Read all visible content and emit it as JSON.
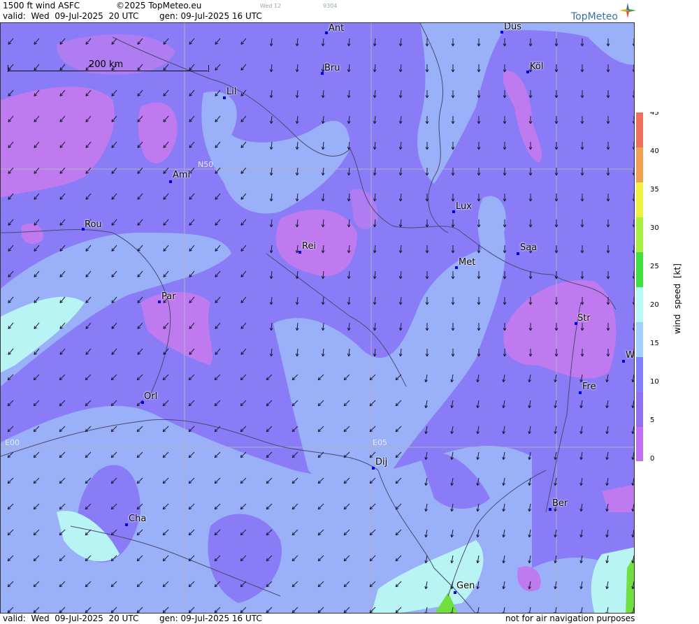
{
  "header": {
    "title": "1500 ft wind ASFC",
    "copyright": "©2025 TopMeteo.eu",
    "day_code": "Wed 12",
    "id_code": "9304",
    "valid": "valid:  Wed  09-Jul-2025  20 UTC",
    "generated": "gen: 09-Jul-2025 16 UTC"
  },
  "logo": {
    "text": "TopMeteo",
    "icon": "compass-star-icon"
  },
  "scale": {
    "label": "200 km"
  },
  "grid_labels": {
    "lat": "N50",
    "lon_w": "E00",
    "lon_e": "E05"
  },
  "cities": [
    {
      "name": "Ant"
    },
    {
      "name": "Düs"
    },
    {
      "name": "Bru"
    },
    {
      "name": "Köl"
    },
    {
      "name": "Lil"
    },
    {
      "name": "Ami"
    },
    {
      "name": "Lux"
    },
    {
      "name": "Rou"
    },
    {
      "name": "Rei"
    },
    {
      "name": "Saa"
    },
    {
      "name": "Met"
    },
    {
      "name": "Par"
    },
    {
      "name": "Str"
    },
    {
      "name": "W"
    },
    {
      "name": "Fre"
    },
    {
      "name": "Orl"
    },
    {
      "name": "Dij"
    },
    {
      "name": "Ber"
    },
    {
      "name": "Cha"
    },
    {
      "name": "Gen"
    }
  ],
  "legend": {
    "label": "wind  speed  [kt]",
    "ticks": [
      "45",
      "40",
      "35",
      "30",
      "25",
      "20",
      "15",
      "10",
      "5",
      "0"
    ],
    "colors": [
      "#f07060",
      "#f0a050",
      "#f0f040",
      "#a8f040",
      "#40e040",
      "#b8f8f8",
      "#a0d0ff",
      "#8080ff",
      "#9070f0",
      "#c070f0"
    ]
  },
  "footer": {
    "valid": "valid:  Wed  09-Jul-2025  20 UTC",
    "generated": "gen: 09-Jul-2025 16 UTC",
    "disclaimer": "not for air navigation purposes"
  }
}
